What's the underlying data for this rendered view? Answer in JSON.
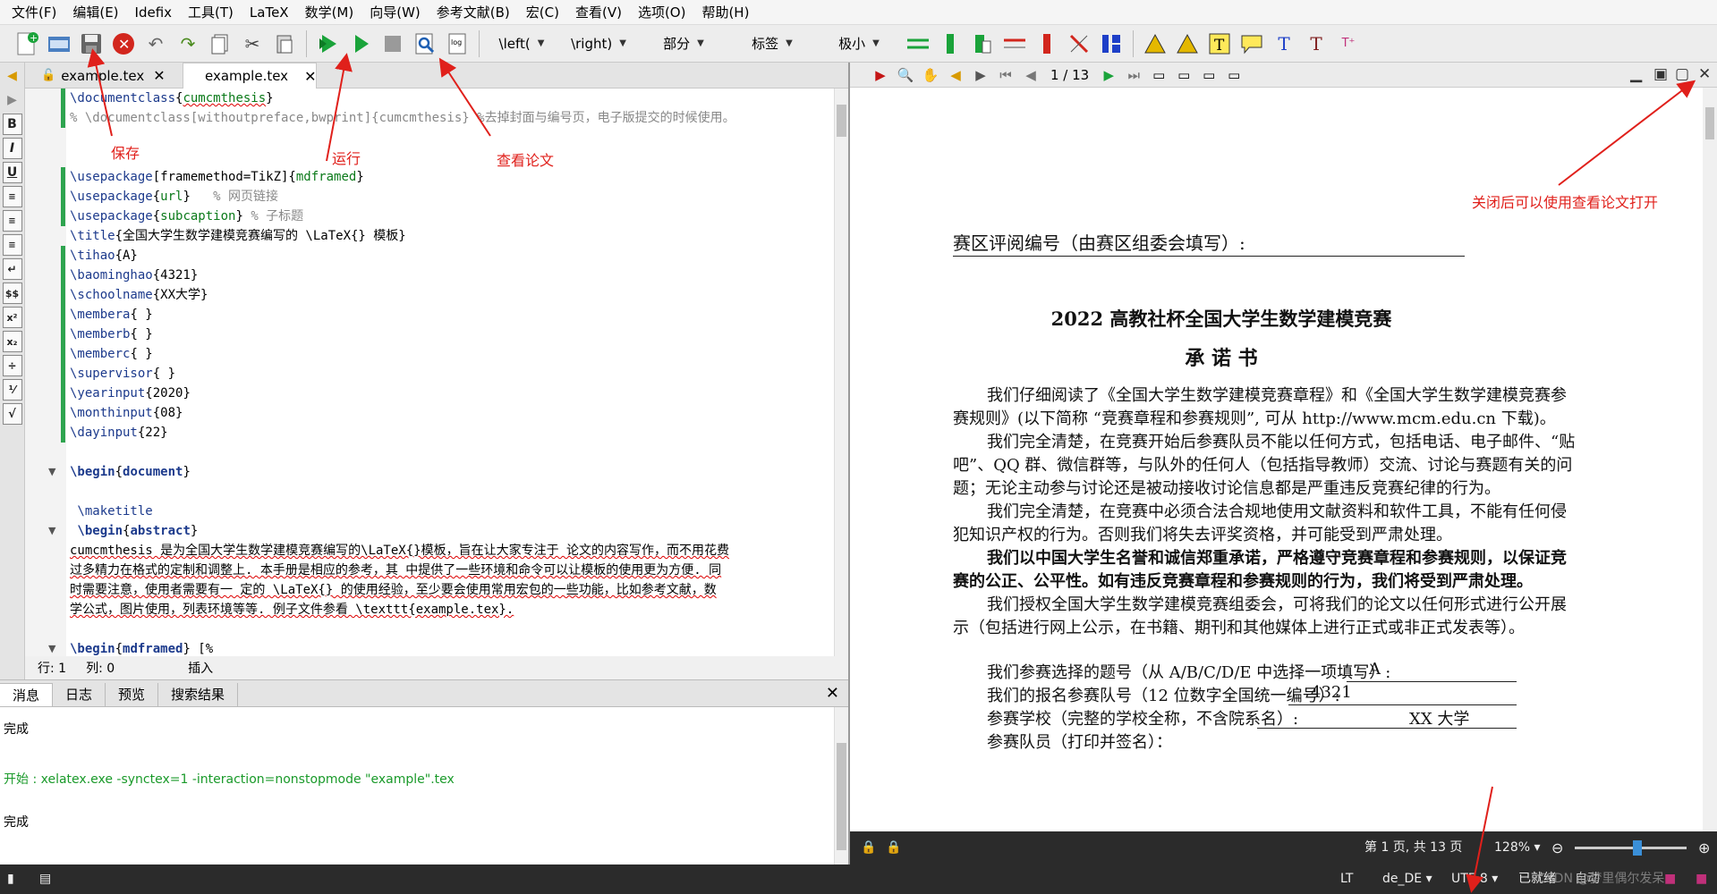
{
  "menu": [
    "文件(F)",
    "编辑(E)",
    "Idefix",
    "工具(T)",
    "LaTeX",
    "数学(M)",
    "向导(W)",
    "参考文献(B)",
    "宏(C)",
    "查看(V)",
    "选项(O)",
    "帮助(H)"
  ],
  "toolbar": {
    "left_paren": "\\left(",
    "right_paren": "\\right)",
    "section": "部分",
    "label": "标签",
    "size": "极小"
  },
  "tabs": [
    {
      "label": "example.tex",
      "close": "✕"
    },
    {
      "label": "example.tex",
      "close": "✕"
    }
  ],
  "editor_lines": [
    [
      {
        "t": "\\documentclass",
        "c": "cmd"
      },
      {
        "t": "{"
      },
      {
        "t": "cumcmthesis",
        "c": "arg err"
      },
      {
        "t": "}"
      }
    ],
    [
      {
        "t": "% \\documentclass[withoutpreface,bwprint]{cumcmthesis} %去掉封面与编号页，电子版提交的时候使用。",
        "c": "com"
      }
    ],
    [],
    [],
    [
      {
        "t": "\\usepackage",
        "c": "cmd"
      },
      {
        "t": "[framemethod=TikZ]{"
      },
      {
        "t": "mdframed",
        "c": "arg"
      },
      {
        "t": "}"
      }
    ],
    [
      {
        "t": "\\usepackage",
        "c": "cmd"
      },
      {
        "t": "{"
      },
      {
        "t": "url",
        "c": "arg"
      },
      {
        "t": "}   "
      },
      {
        "t": "% 网页链接",
        "c": "com"
      }
    ],
    [
      {
        "t": "\\usepackage",
        "c": "cmd"
      },
      {
        "t": "{"
      },
      {
        "t": "subcaption",
        "c": "arg"
      },
      {
        "t": "} "
      },
      {
        "t": "% 子标题",
        "c": "com"
      }
    ],
    [
      {
        "t": "\\title",
        "c": "cmd"
      },
      {
        "t": "{全国大学生数学建模竞赛编写的 \\LaTeX{} 模板}"
      }
    ],
    [
      {
        "t": "\\tihao",
        "c": "cmd"
      },
      {
        "t": "{A}"
      }
    ],
    [
      {
        "t": "\\baominghao",
        "c": "cmd"
      },
      {
        "t": "{4321}"
      }
    ],
    [
      {
        "t": "\\schoolname",
        "c": "cmd"
      },
      {
        "t": "{XX大学}"
      }
    ],
    [
      {
        "t": "\\membera",
        "c": "cmd"
      },
      {
        "t": "{ }"
      }
    ],
    [
      {
        "t": "\\memberb",
        "c": "cmd"
      },
      {
        "t": "{ }"
      }
    ],
    [
      {
        "t": "\\memberc",
        "c": "cmd"
      },
      {
        "t": "{ }"
      }
    ],
    [
      {
        "t": "\\supervisor",
        "c": "cmd"
      },
      {
        "t": "{ }"
      }
    ],
    [
      {
        "t": "\\yearinput",
        "c": "cmd"
      },
      {
        "t": "{2020}"
      }
    ],
    [
      {
        "t": "\\monthinput",
        "c": "cmd"
      },
      {
        "t": "{08}"
      }
    ],
    [
      {
        "t": "\\dayinput",
        "c": "cmd"
      },
      {
        "t": "{22}"
      }
    ],
    [],
    [
      {
        "t": "\\begin",
        "c": "cmd bold"
      },
      {
        "t": "{"
      },
      {
        "t": "document",
        "c": "cmd bold"
      },
      {
        "t": "}"
      }
    ],
    [],
    [
      {
        "t": " \\maketitle",
        "c": "cmd"
      }
    ],
    [
      {
        "t": " \\begin",
        "c": "cmd bold"
      },
      {
        "t": "{"
      },
      {
        "t": "abstract",
        "c": "cmd bold"
      },
      {
        "t": "}"
      }
    ],
    [
      {
        "t": "cumcmthesis 是为全国大学生数学建模竞赛编写的\\LaTeX{}模板，旨在让大家专注于 论文的内容写作，而不用花费",
        "c": "err"
      }
    ],
    [
      {
        "t": "过多精力在格式的定制和调整上. 本手册是相应的参考，其 中提供了一些环境和命令可以让模板的使用更为方便. 同",
        "c": "err"
      }
    ],
    [
      {
        "t": "时需要注意，使用者需要有一 定的 \\LaTeX{} 的使用经验，至少要会使用常用宏包的一些功能，比如参考文献，数",
        "c": "err"
      }
    ],
    [
      {
        "t": "学公式，图片使用，列表环境等等. 例子文件参看 \\texttt{example.tex}.",
        "c": "err"
      }
    ],
    [],
    [
      {
        "t": "\\begin",
        "c": "cmd bold"
      },
      {
        "t": "{"
      },
      {
        "t": "mdframed",
        "c": "cmd bold"
      },
      {
        "t": "} [%"
      }
    ]
  ],
  "status": {
    "row_label": "行:  1",
    "col_label": "列:  0",
    "mode": "插入"
  },
  "message_tabs": [
    "消息",
    "日志",
    "预览",
    "搜索结果"
  ],
  "messages": {
    "line1": "完成",
    "line2": "开始 : xelatex.exe -synctex=1 -interaction=nonstopmode \"example\".tex",
    "line3": "完成"
  },
  "viewer": {
    "page_indicator": "1 / 13",
    "page_status": "第 1 页, 共 13 页",
    "zoom": "128% ▾"
  },
  "paper": {
    "review_no": "赛区评阅编号（由赛区组委会填写）:",
    "title": "2022 高教社杯全国大学生数学建模竞赛",
    "subtitle": "承  诺  书",
    "p1a": "我们仔细阅读了《全国大学生数学建模竞赛章程》和《全国大学生数学建模竞赛参",
    "p1b": "赛规则》(以下简称 “竞赛章程和参赛规则”, 可从 http://www.mcm.edu.cn 下载)。",
    "p2a": "我们完全清楚，在竞赛开始后参赛队员不能以任何方式，包括电话、电子邮件、“贴",
    "p2b": "吧”、QQ 群、微信群等，与队外的任何人（包括指导教师）交流、讨论与赛题有关的问",
    "p2c": "题；无论主动参与讨论还是被动接收讨论信息都是严重违反竞赛纪律的行为。",
    "p3a": "我们完全清楚，在竞赛中必须合法合规地使用文献资料和软件工具，不能有任何侵",
    "p3b": "犯知识产权的行为。否则我们将失去评奖资格，并可能受到严肃处理。",
    "p4a": "我们以中国大学生名誉和诚信郑重承诺，严格遵守竞赛章程和参赛规则，以保证竞",
    "p4b": "赛的公正、公平性。如有违反竞赛章程和参赛规则的行为，我们将受到严肃处理。",
    "p5a": "我们授权全国大学生数学建模竞赛组委会，可将我们的论文以任何形式进行公开展",
    "p5b": "示（包括进行网上公示，在书籍、期刊和其他媒体上进行正式或非正式发表等）。",
    "q1": "我们参赛选择的题号（从 A/B/C/D/E 中选择一项填写）:",
    "a1": "A",
    "q2": "我们的报名参赛队号（12 位数字全国统一编号）:",
    "a2": "4321",
    "q3": "参赛学校（完整的学校全称，不含院系名）:",
    "a3": "XX 大学",
    "q4": "参赛队员（打印并签名）："
  },
  "bottombar": {
    "lt": "LT",
    "lang": "de_DE ▾",
    "encoding": "UTF-8 ▾",
    "ready": "已就绪",
    "auto": "自动",
    "watermark": "CSDN @梦里偶尔发呆"
  },
  "annotations": {
    "save": "保存",
    "run": "运行",
    "view": "查看论文",
    "close_hint": "关闭后可以使用查看论文打开"
  },
  "colors": {
    "annotation": "#e0201b",
    "command": "#1c3a8c",
    "argument": "#0b7a1a"
  }
}
